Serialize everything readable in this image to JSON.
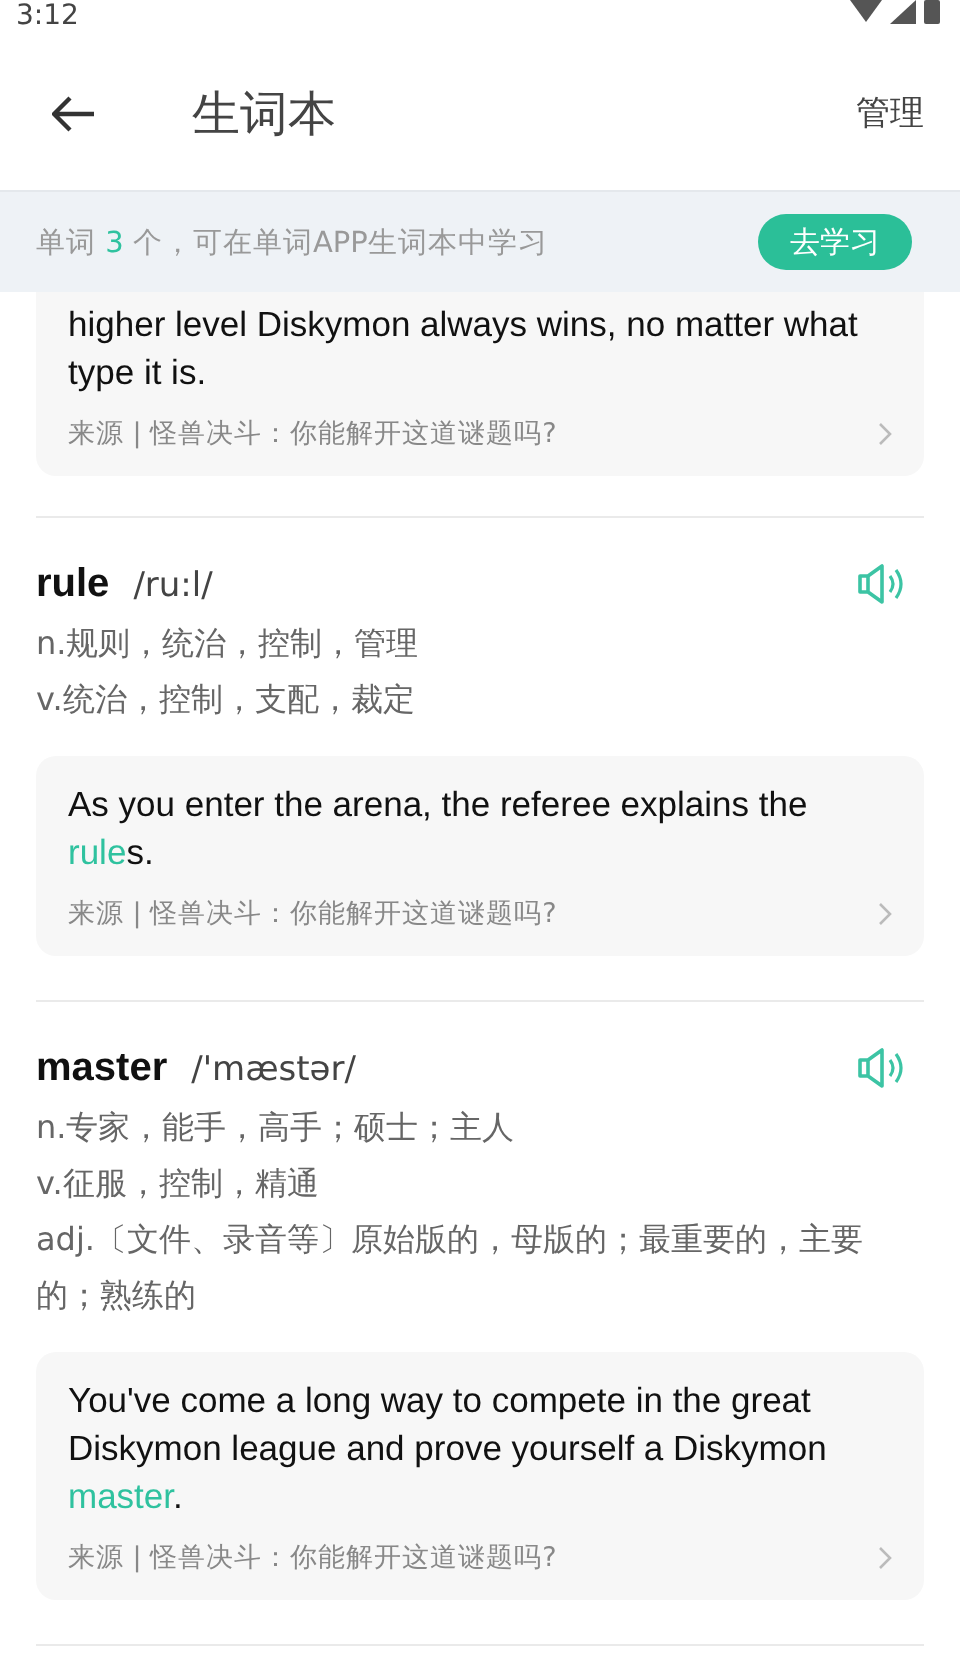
{
  "status_bar": {
    "time": "3:12"
  },
  "header": {
    "title": "生词本",
    "action": "管理"
  },
  "banner": {
    "before": "单词 ",
    "count": "3",
    "after": " 个，可在单词APP生词本中学习",
    "button": "去学习"
  },
  "entries": [
    {
      "example": {
        "parts": [
          {
            "text": "higher level Diskymon always wins, no matter what type it is.",
            "highlight": false
          }
        ],
        "source": "来源 | 怪兽决斗：你能解开这道谜题吗?"
      }
    },
    {
      "word": "rule",
      "phonetic": "/ru:l/",
      "meanings": [
        "n.规则，统治，控制，管理",
        "v.统治，控制，支配，裁定"
      ],
      "example": {
        "parts": [
          {
            "text": "As you enter the arena, the referee explains the ",
            "highlight": false
          },
          {
            "text": "rule",
            "highlight": true
          },
          {
            "text": "s.",
            "highlight": false
          }
        ],
        "source": "来源 | 怪兽决斗：你能解开这道谜题吗?"
      }
    },
    {
      "word": "master",
      "phonetic": "/'mæstər/",
      "meanings": [
        "n.专家，能手，高手；硕士；主人",
        "v.征服，控制，精通",
        "adj.〔文件、录音等〕原始版的，母版的；最重要的，主要的；熟练的"
      ],
      "example": {
        "parts": [
          {
            "text": "You've come a long way to compete in the great Diskymon league and prove yourself a Diskymon ",
            "highlight": false
          },
          {
            "text": "master",
            "highlight": true
          },
          {
            "text": ".",
            "highlight": false
          }
        ],
        "source": "来源 | 怪兽决斗：你能解开这道谜题吗?"
      }
    }
  ]
}
